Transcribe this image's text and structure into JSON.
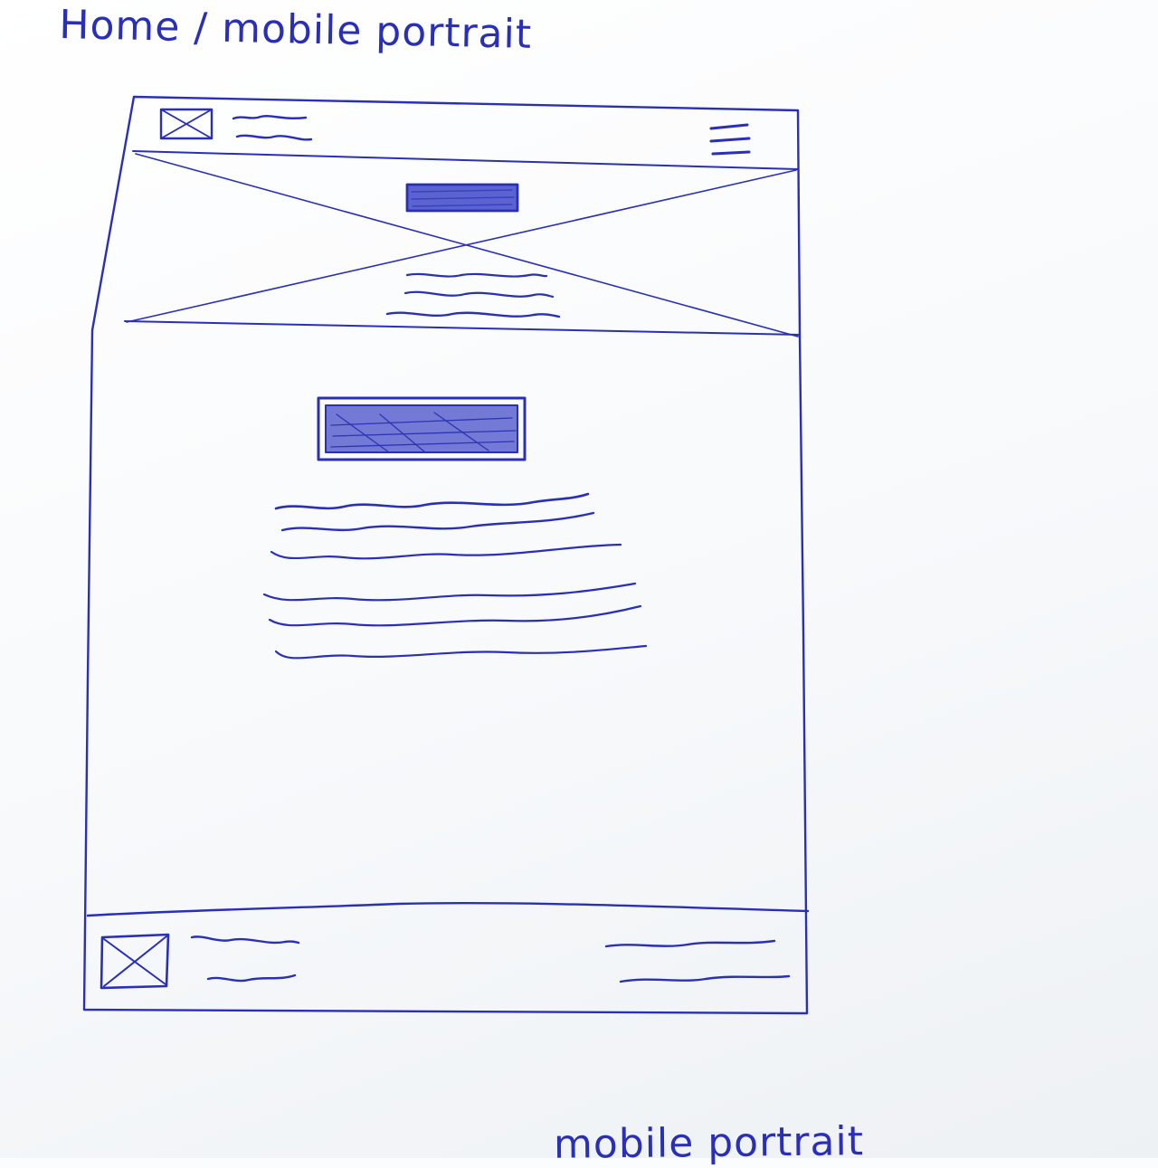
{
  "sketch": {
    "title": "Home / mobile portrait",
    "bottom_caption": "mobile portrait"
  },
  "colors": {
    "ink": "#2a2fb8",
    "paper": "#fbfcfd",
    "button_fill": "#5a63cf"
  },
  "wireframe": {
    "header": {
      "logo": "image-placeholder-icon",
      "menu": "hamburger-icon",
      "text_lines": 2
    },
    "hero": {
      "background": "image-placeholder-icon",
      "button": "filled-button",
      "text_lines": 3
    },
    "content": {
      "button": "filled-button",
      "text_lines": 6
    },
    "footer": {
      "logo": "image-placeholder-icon",
      "left_text_lines": 2,
      "right_text_lines": 2
    }
  }
}
